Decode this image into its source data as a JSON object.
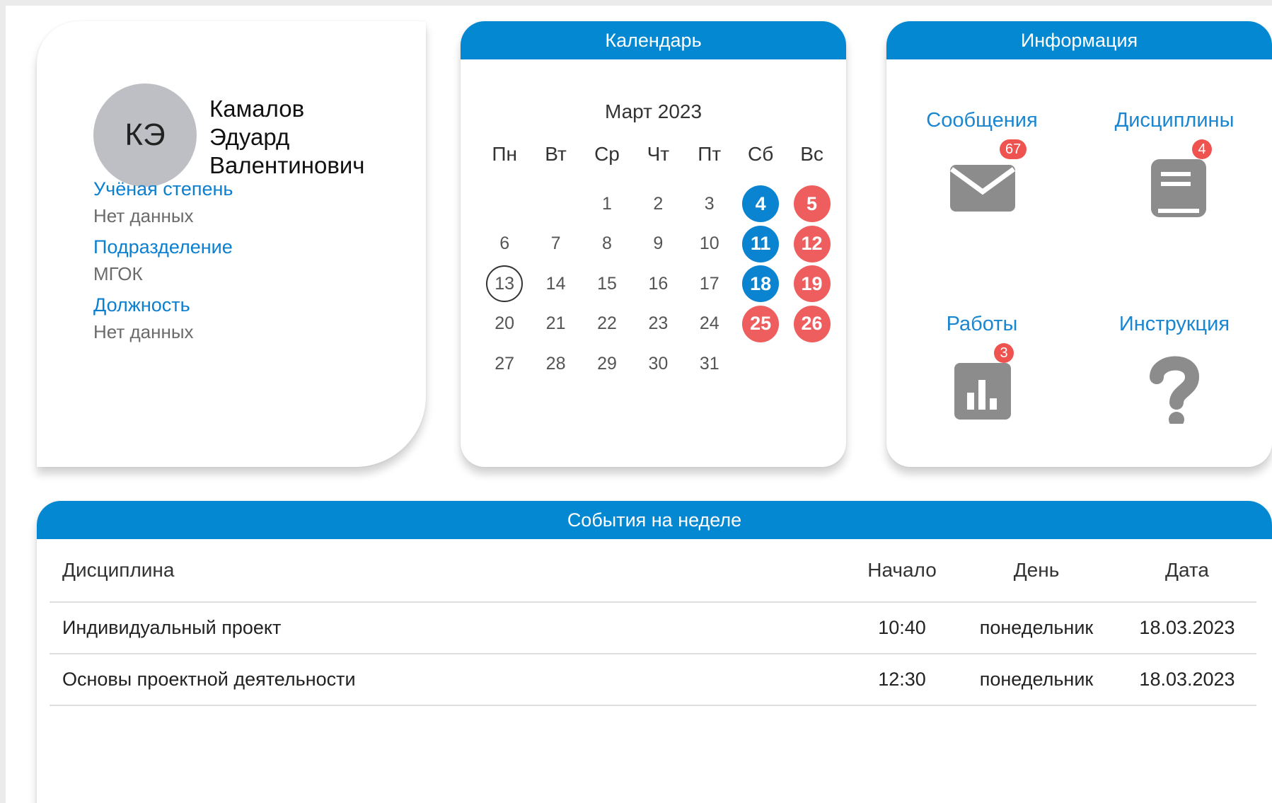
{
  "profile": {
    "initials": "КЭ",
    "name": [
      "Камалов",
      "Эдуард",
      "Валентинович"
    ],
    "fields": [
      {
        "label": "Учёная степень",
        "value": "Нет данных"
      },
      {
        "label": "Подразделение",
        "value": "МГОК"
      },
      {
        "label": "Должность",
        "value": "Нет данных"
      }
    ]
  },
  "calendar": {
    "title": "Календарь",
    "month": "Март 2023",
    "weekdays": [
      "Пн",
      "Вт",
      "Ср",
      "Чт",
      "Пт",
      "Сб",
      "Вс"
    ],
    "weeks": [
      [
        "",
        "",
        "1",
        "2",
        "3",
        "4",
        "5"
      ],
      [
        "6",
        "7",
        "8",
        "9",
        "10",
        "11",
        "12"
      ],
      [
        "13",
        "14",
        "15",
        "16",
        "17",
        "18",
        "19"
      ],
      [
        "20",
        "21",
        "22",
        "23",
        "24",
        "25",
        "26"
      ],
      [
        "27",
        "28",
        "29",
        "30",
        "31",
        "",
        ""
      ]
    ],
    "today": "13",
    "blue_days": [
      "4",
      "11",
      "18"
    ],
    "red_days": [
      "5",
      "12",
      "19",
      "25",
      "26"
    ]
  },
  "info": {
    "title": "Информация",
    "tiles": [
      {
        "label": "Сообщения",
        "badge": "67",
        "icon": "envelope-icon"
      },
      {
        "label": "Дисциплины",
        "badge": "4",
        "icon": "book-icon"
      },
      {
        "label": "Работы",
        "badge": "3",
        "icon": "bar-chart-icon"
      },
      {
        "label": "Инструкция",
        "badge": "",
        "icon": "question-icon"
      }
    ]
  },
  "events": {
    "title": "События на неделе",
    "columns": [
      "Дисциплина",
      "Начало",
      "День",
      "Дата"
    ],
    "rows": [
      [
        "Индивидуальный проект",
        "10:40",
        "понедельник",
        "18.03.2023"
      ],
      [
        "Основы проектной деятельности",
        "12:30",
        "понедельник",
        "18.03.2023"
      ]
    ]
  },
  "colors": {
    "accent": "#0388d1",
    "link": "#1b86d0",
    "weekend_red": "#ef5e5e",
    "badge": "#ef5350",
    "icon_gray": "#8c8c8c"
  }
}
